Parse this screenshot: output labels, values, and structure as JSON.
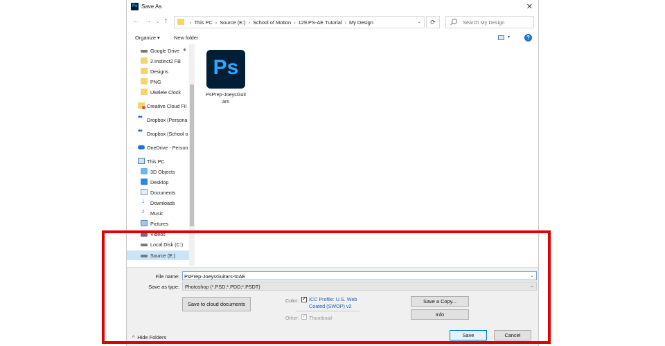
{
  "window": {
    "title": "Save As",
    "app_icon": "Ps"
  },
  "nav": {
    "breadcrumbs": [
      "This PC",
      "Source (E:)",
      "School of Motion",
      "129.PS-AE Tutorial",
      "My Design"
    ],
    "search_placeholder": "Search My Design",
    "refresh_icon": "⟳"
  },
  "toolbar": {
    "organize": "Organize ▾",
    "new_folder": "New folder",
    "help": "?"
  },
  "sidebar": {
    "items": [
      {
        "label": "Google Drive",
        "icon": "drive",
        "pinned": true
      },
      {
        "label": "2.Instinct2 FB",
        "icon": "folder"
      },
      {
        "label": "Designs",
        "icon": "folder"
      },
      {
        "label": "PNG",
        "icon": "folder"
      },
      {
        "label": "Ukelele Clock",
        "icon": "folder"
      },
      {
        "label": "Creative Cloud Fil",
        "icon": "creative-cloud"
      },
      {
        "label": "Dropbox (Persona",
        "icon": "dropbox"
      },
      {
        "label": "Dropbox (School o",
        "icon": "dropbox"
      },
      {
        "label": "OneDrive - Person",
        "icon": "onedrive"
      },
      {
        "label": "This PC",
        "icon": "pc"
      },
      {
        "label": "3D Objects",
        "icon": "3d"
      },
      {
        "label": "Desktop",
        "icon": "desktop"
      },
      {
        "label": "Documents",
        "icon": "documents"
      },
      {
        "label": "Downloads",
        "icon": "downloads"
      },
      {
        "label": "Music",
        "icon": "music"
      },
      {
        "label": "Pictures",
        "icon": "pictures"
      },
      {
        "label": "Videos",
        "icon": "videos"
      },
      {
        "label": "Local Disk (C:)",
        "icon": "drive"
      },
      {
        "label": "Source (E:)",
        "icon": "drive",
        "selected": true
      }
    ]
  },
  "files": [
    {
      "name_line1": "PsPrep-JoeysGuit",
      "name_line2": "ars",
      "icon_text": "Ps"
    }
  ],
  "form": {
    "file_name_label": "File name:",
    "file_name_value": "PsPrep-JoeysGuitars-toAE",
    "save_type_label": "Save as type:",
    "save_type_value": "Photoshop (*.PSD;*.PDD;*.PSDT)",
    "save_to_cloud": "Save to cloud documents",
    "color_label": "Color:",
    "icc_line1": "ICC Profile:  U.S. Web",
    "icc_line2": "Coated (SWOP) v2",
    "icc_checked": true,
    "other_label": "Other:",
    "thumbnail_label": "Thumbnail",
    "thumbnail_checked": true,
    "save_copy": "Save a Copy...",
    "info": "Info",
    "hide_folders": "Hide Folders",
    "save": "Save",
    "cancel": "Cancel"
  },
  "colors": {
    "highlight": "#e00000",
    "ps_bg": "#001e36",
    "ps_text": "#31a8ff",
    "selected": "#cce4f7"
  }
}
